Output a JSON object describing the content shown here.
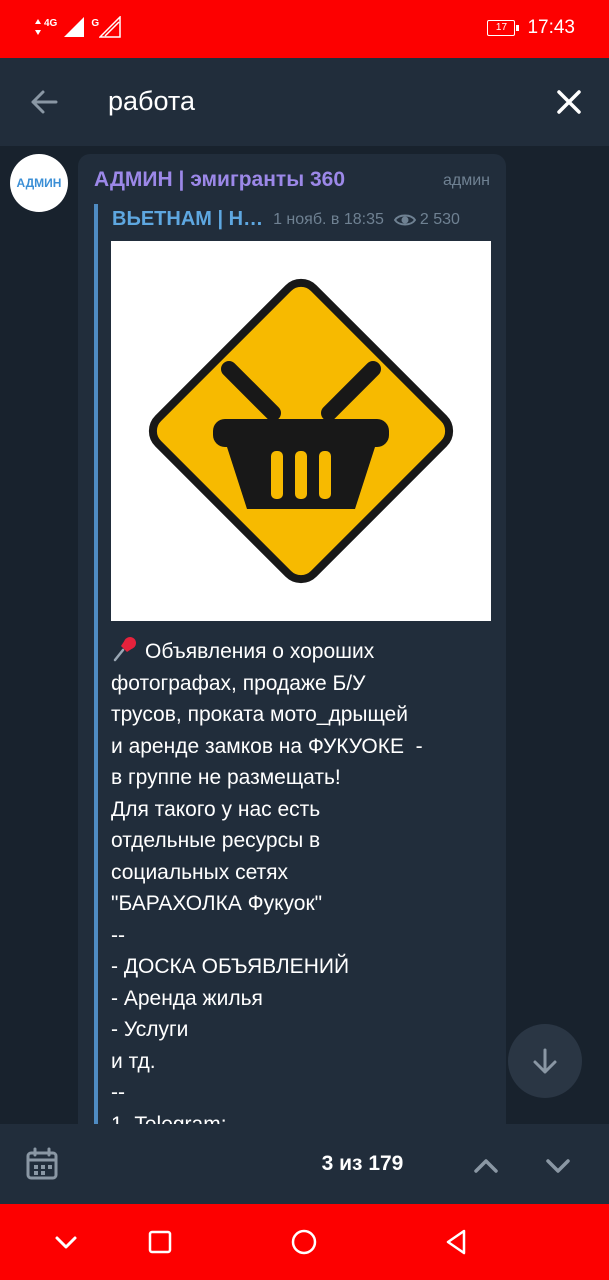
{
  "status_bar": {
    "network_label": "4G",
    "network2_label": "G",
    "battery": "17",
    "time": "17:43",
    "color": "#fd0000"
  },
  "search": {
    "query": "работа",
    "back_icon": "arrow-left-icon",
    "close_icon": "close-icon"
  },
  "message": {
    "avatar_text": "АДМИН",
    "sender": "АДМИН | эмигранты 360",
    "role": "админ",
    "forwarded_from": "ВЬЕТНАМ | Н…",
    "date": "1 нояб. в 18:35",
    "views": "2 530",
    "image": "yellow-warning-sign-shopping-basket",
    "text": "Объявления о хороших фотографах, продаже Б/У\nтрусов, проката мото_дрыщей\nи аренде замков на ФУКУОКЕ  -\nв группе не размещать!\nДля такого у нас есть\nотдельные ресурсы в\nсоциальных сетях\n\"БАРАХОЛКА Фукуок\"\n--\n- ДОСКА ОБЪЯВЛЕНИЙ\n- Аренда жилья\n- Услуги\nи тд.\n--\n1. Telegram:"
  },
  "bottom_bar": {
    "counter": "3 из 179"
  },
  "colors": {
    "background": "#18222d",
    "panel": "#212d3b",
    "sender": "#9c88e8",
    "link": "#5ea7e0",
    "muted": "#6f8192"
  }
}
